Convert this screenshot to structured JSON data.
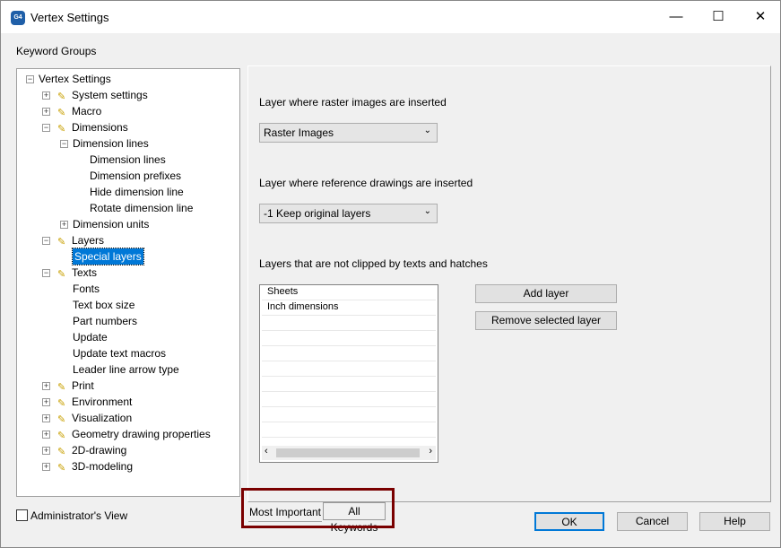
{
  "window": {
    "title": "Vertex Settings",
    "app_icon": "G4",
    "minimize": "—",
    "maximize": "☐",
    "close": "✕"
  },
  "keyword_groups_label": "Keyword Groups",
  "tree": [
    {
      "label": "Vertex Settings",
      "level": 0,
      "expander": "-",
      "icon": false
    },
    {
      "label": "System settings",
      "level": 1,
      "expander": "+",
      "icon": true
    },
    {
      "label": "Macro",
      "level": 1,
      "expander": "+",
      "icon": true
    },
    {
      "label": "Dimensions",
      "level": 1,
      "expander": "-",
      "icon": true
    },
    {
      "label": "Dimension lines",
      "level": 2,
      "expander": "-",
      "icon": false
    },
    {
      "label": "Dimension lines",
      "level": 3,
      "expander": "",
      "icon": false
    },
    {
      "label": "Dimension prefixes",
      "level": 3,
      "expander": "",
      "icon": false
    },
    {
      "label": "Hide dimension line",
      "level": 3,
      "expander": "",
      "icon": false
    },
    {
      "label": "Rotate dimension line",
      "level": 3,
      "expander": "",
      "icon": false
    },
    {
      "label": "Dimension units",
      "level": 2,
      "expander": "+",
      "icon": false
    },
    {
      "label": "Layers",
      "level": 1,
      "expander": "-",
      "icon": true
    },
    {
      "label": "Special layers",
      "level": 2,
      "expander": "",
      "icon": false,
      "selected": true
    },
    {
      "label": "Texts",
      "level": 1,
      "expander": "-",
      "icon": true
    },
    {
      "label": "Fonts",
      "level": 2,
      "expander": "",
      "icon": false
    },
    {
      "label": "Text box size",
      "level": 2,
      "expander": "",
      "icon": false
    },
    {
      "label": "Part numbers",
      "level": 2,
      "expander": "",
      "icon": false
    },
    {
      "label": "Update",
      "level": 2,
      "expander": "",
      "icon": false
    },
    {
      "label": "Update text macros",
      "level": 2,
      "expander": "",
      "icon": false
    },
    {
      "label": "Leader line arrow type",
      "level": 2,
      "expander": "",
      "icon": false
    },
    {
      "label": "Print",
      "level": 1,
      "expander": "+",
      "icon": true
    },
    {
      "label": "Environment",
      "level": 1,
      "expander": "+",
      "icon": true
    },
    {
      "label": "Visualization",
      "level": 1,
      "expander": "+",
      "icon": true
    },
    {
      "label": "Geometry drawing properties",
      "level": 1,
      "expander": "+",
      "icon": true
    },
    {
      "label": "2D-drawing",
      "level": 1,
      "expander": "+",
      "icon": true
    },
    {
      "label": "3D-modeling",
      "level": 1,
      "expander": "+",
      "icon": true
    }
  ],
  "panel": {
    "raster_label": "Layer where raster images are inserted",
    "raster_value": "Raster Images",
    "reference_label": "Layer where reference drawings are inserted",
    "reference_value": "-1 Keep original layers",
    "notclipped_label": "Layers that are not clipped by texts and hatches",
    "layers": [
      "Sheets",
      "Inch dimensions"
    ],
    "add_layer": "Add layer",
    "remove_layer": "Remove selected layer"
  },
  "tabs": [
    "Most Important",
    "All Keywords"
  ],
  "admin_view": {
    "label": "Administrator's View",
    "checked": false
  },
  "buttons": {
    "ok": "OK",
    "cancel": "Cancel",
    "help": "Help"
  }
}
